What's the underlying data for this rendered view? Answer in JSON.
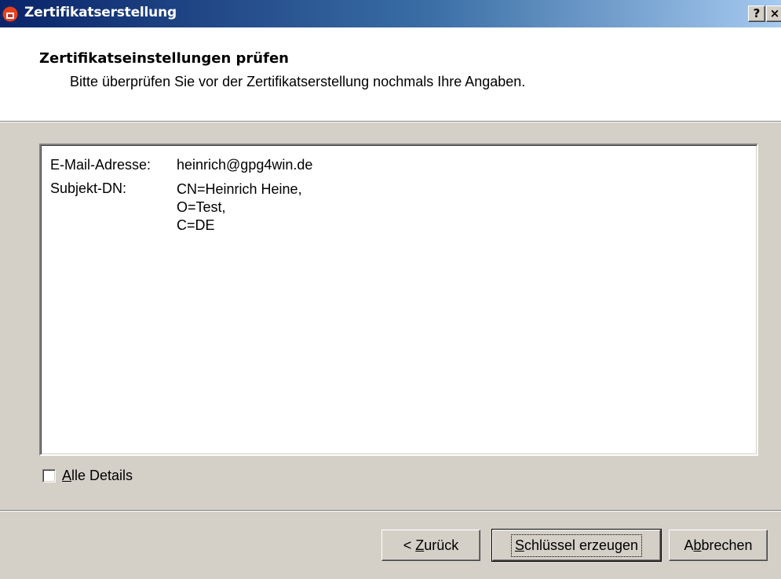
{
  "window": {
    "title": "Zertifikatserstellung",
    "help_label": "?",
    "close_label": "×"
  },
  "header": {
    "title": "Zertifikatseinstellungen prüfen",
    "subtitle": "Bitte überprüfen Sie vor der Zertifikatserstellung nochmals Ihre Angaben."
  },
  "summary": {
    "email_label": "E-Mail-Adresse:",
    "email_value": "heinrich@gpg4win.de",
    "subject_label": "Subjekt-DN:",
    "subject_lines": [
      "CN=Heinrich Heine,",
      "O=Test,",
      "C=DE"
    ]
  },
  "options": {
    "all_details_label_rest": "lle Details",
    "all_details_accel": "A",
    "all_details_checked": false
  },
  "buttons": {
    "back_prefix": "< ",
    "back_accel": "Z",
    "back_rest": "urück",
    "create_accel": "S",
    "create_rest": "chlüssel erzeugen",
    "cancel_prefix": "A",
    "cancel_accel": "b",
    "cancel_rest": "brechen"
  },
  "colors": {
    "titlebar_start": "#0a246a",
    "titlebar_end": "#a6caf0",
    "dialog_bg": "#d4d0c8"
  }
}
